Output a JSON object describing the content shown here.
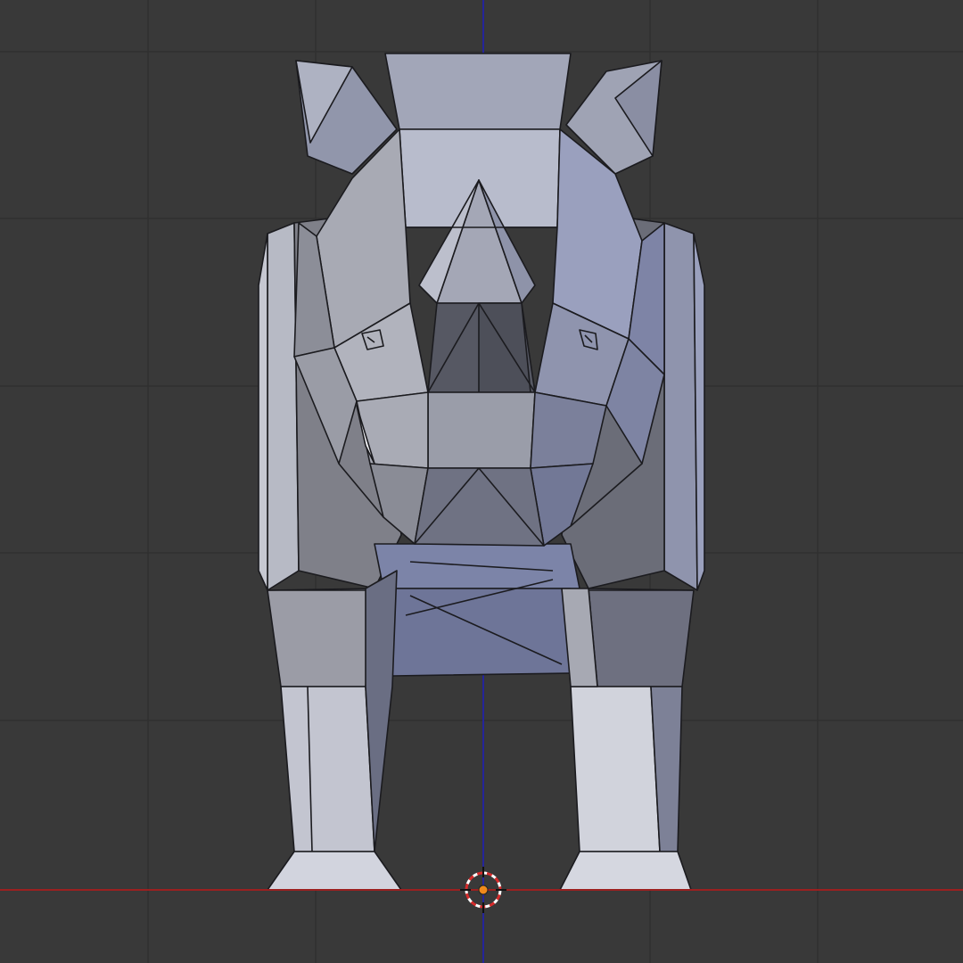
{
  "viewport": {
    "view": "front-orthographic",
    "object": "low-poly-rhino",
    "shading": "solid",
    "colors": {
      "background": "#393939",
      "grid": "#2f2f2f",
      "x_axis": "#9b2020",
      "z_axis": "#25259a",
      "mesh_base": "#9a9fb3",
      "mesh_edge": "#1b1b1f",
      "cursor": "#d62b2b",
      "origin": "#f08a1c"
    },
    "icons": {
      "cursor": "3d-cursor-icon",
      "origin": "object-origin-icon"
    }
  }
}
